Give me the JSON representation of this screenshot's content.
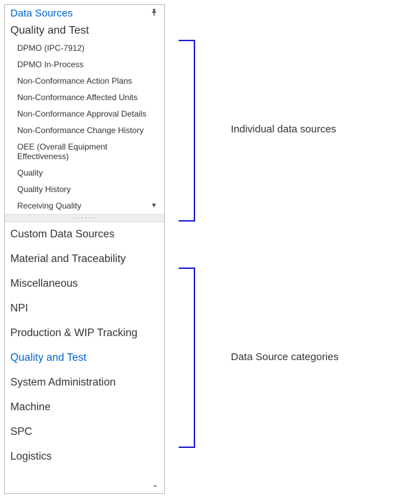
{
  "panel": {
    "title": "Data Sources",
    "expanded_category": "Quality and Test",
    "data_sources": [
      "DPMO (IPC-7912)",
      "DPMO In-Process",
      "Non-Conformance Action Plans",
      "Non-Conformance Affected Units",
      "Non-Conformance Approval Details",
      "Non-Conformance Change History",
      "OEE (Overall Equipment Effectiveness)",
      "Quality",
      "Quality History",
      "Receiving Quality"
    ],
    "categories": [
      {
        "label": "Custom Data Sources",
        "active": false
      },
      {
        "label": "Material and Traceability",
        "active": false
      },
      {
        "label": "Miscellaneous",
        "active": false
      },
      {
        "label": "NPI",
        "active": false
      },
      {
        "label": "Production & WIP Tracking",
        "active": false
      },
      {
        "label": "Quality and Test",
        "active": true
      },
      {
        "label": "System Administration",
        "active": false
      },
      {
        "label": "Machine",
        "active": false
      },
      {
        "label": "SPC",
        "active": false
      },
      {
        "label": "Logistics",
        "active": false
      }
    ]
  },
  "annotations": {
    "individual": "Individual data sources",
    "categories": "Data Source categories"
  },
  "colors": {
    "accent": "#0066cc",
    "bracket": "#1b1bd6"
  }
}
